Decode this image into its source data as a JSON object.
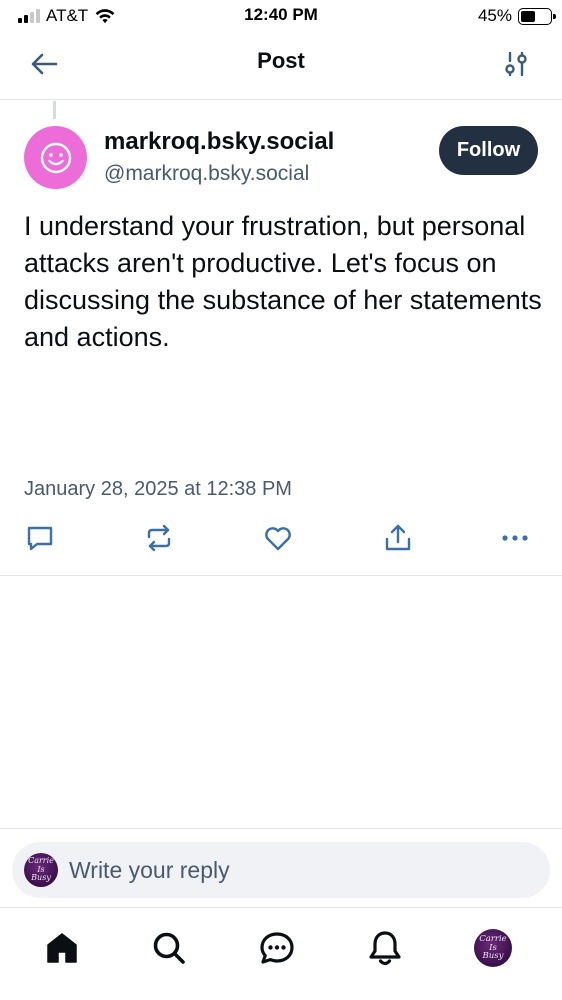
{
  "status_bar": {
    "carrier": "AT&T",
    "time": "12:40 PM",
    "battery_percent": "45%",
    "battery_level": 0.45,
    "signal_bars_active": 2
  },
  "header": {
    "title": "Post",
    "back_icon": "arrow-left-icon",
    "filter_icon": "sliders-icon"
  },
  "post": {
    "author": {
      "display_name": "markroq.bsky.social",
      "handle": "@markroq.bsky.social",
      "avatar_icon": "smiley-face-icon",
      "avatar_color": "#ec6cd8"
    },
    "follow_label": "Follow",
    "text": "I understand your frustration, but personal attacks aren't productive. Let's focus on discussing the substance of her statements and actions.",
    "timestamp": "January 28, 2025 at 12:38 PM",
    "actions": [
      "reply-icon",
      "repost-icon",
      "like-icon",
      "share-icon",
      "more-icon"
    ]
  },
  "reply_bar": {
    "placeholder": "Write your reply",
    "avatar_text": "Carrie Is Busy"
  },
  "bottom_nav": {
    "items": [
      "home-icon",
      "search-icon",
      "chat-icon",
      "notifications-icon",
      "profile-avatar"
    ],
    "avatar_text": "Carrie Is Busy"
  },
  "colors": {
    "accent_dark": "#233041",
    "muted_text": "#4a5a6e",
    "icon_blue": "#3a6fa8"
  }
}
